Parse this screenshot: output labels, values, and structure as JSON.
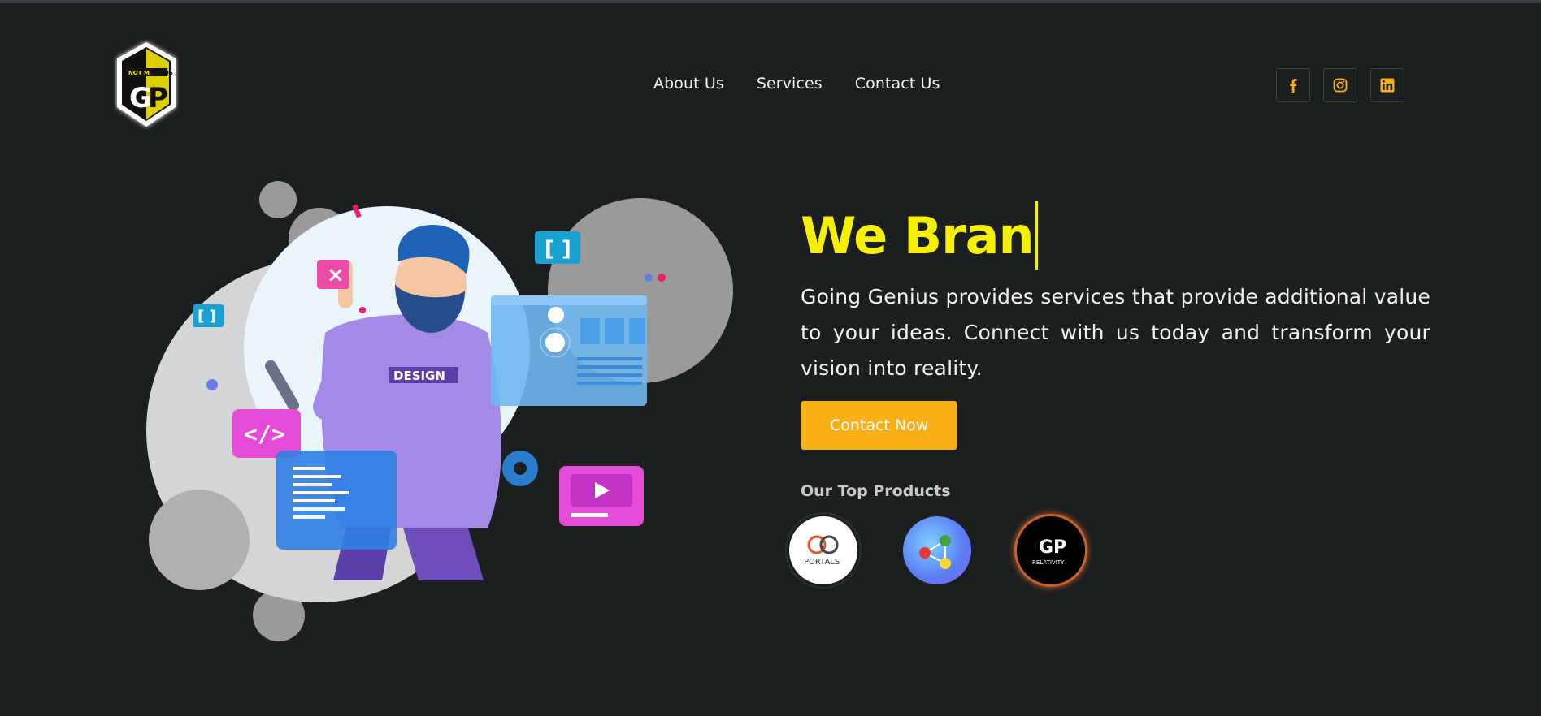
{
  "header": {
    "logo_alt": "Going Genius logo",
    "logo_text_left": "NOT ME",
    "logo_text_right": "BUT US",
    "nav": [
      {
        "label": "About Us"
      },
      {
        "label": "Services"
      },
      {
        "label": "Contact Us"
      }
    ],
    "socials": [
      {
        "icon": "facebook-icon"
      },
      {
        "icon": "instagram-icon"
      },
      {
        "icon": "linkedin-icon"
      }
    ]
  },
  "hero": {
    "headline": "We Bran",
    "description": "Going Genius provides services that provide additional value to your ideas. Connect with us today and transform your vision into reality.",
    "cta_label": "Contact Now",
    "products_title": "Our Top Products",
    "products": [
      {
        "name": "PORTALS"
      },
      {
        "name": "network-graph-product"
      },
      {
        "name": "RELATIVITY"
      }
    ],
    "art_label": "DESIGN"
  },
  "colors": {
    "background": "#1c1f20",
    "headline": "#f5f000",
    "accent": "#fbaf17",
    "text": "#f2f2f2"
  }
}
